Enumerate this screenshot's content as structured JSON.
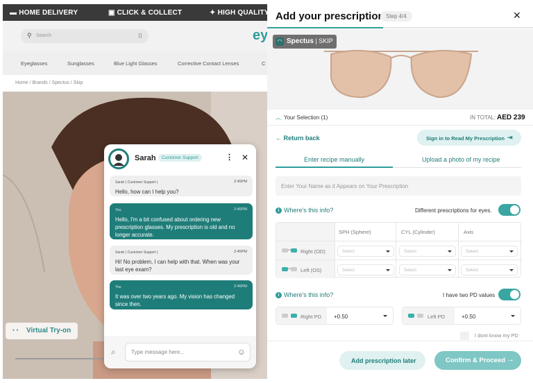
{
  "store": {
    "promo": [
      "HOME DELIVERY",
      "CLICK & COLLECT",
      "HIGH QUALITY"
    ],
    "logo_partial": "ey",
    "search_placeholder": "Search",
    "nav": [
      "Eyeglasses",
      "Sunglasses",
      "Blue Light Glasses",
      "Corrective Contact Lenses",
      "C"
    ],
    "breadcrumb": "Home / Brands / Spectus / Skip",
    "virtual_tryon": "Virtual Try-on"
  },
  "chat": {
    "agent_name": "Sarah",
    "agent_role": "Customer Support",
    "messages": [
      {
        "from": "Sarah ( Customer Support )",
        "time": "2:45PM",
        "text": "Hello, how can I help you?",
        "kind": "agent"
      },
      {
        "from": "You",
        "time": "2:46PM",
        "text": "Hello, I'm a bit confused about ordering new prescription glasses. My prescription is old and no longer accurate.",
        "kind": "user"
      },
      {
        "from": "Sarah ( Customer Support )",
        "time": "2:45PM",
        "text": "Hi! No problem, I can help with that. When was your last eye exam?",
        "kind": "agent"
      },
      {
        "from": "You",
        "time": "2:46PM",
        "text": "It was over two years ago. My vision has changed since then.",
        "kind": "user"
      }
    ],
    "input_placeholder": "Type message here..."
  },
  "panel": {
    "title": "Add your prescription",
    "step": "Step 4/4",
    "brand_tag": {
      "brand": "Spectus",
      "model": " | SKIP"
    },
    "selection_label": "Your Selection (1)",
    "total_label": "IN TOTAL:",
    "total_value": "AED 239",
    "return_back": "Return back",
    "sign_in": "Sign in to Read My Prescription",
    "tabs": [
      "Enter recipe manually",
      "Upload a photo of my recipe"
    ],
    "name_placeholder": "Enter Your Name as it Appears on Your Prescription",
    "where_info": "Where's this info?",
    "different_rx": "Different prescriptions for eyes.",
    "rx_columns": [
      "SPH (Sphere)",
      "CYL (Cylinder)",
      "Axis"
    ],
    "rx_rows": [
      "Right (OD)",
      "Left (OS)"
    ],
    "select_placeholder": "Select",
    "two_pd": "I have two PD values",
    "right_pd_label": "Right PD",
    "right_pd_value": "+0.50",
    "left_pd_label": "Left PD",
    "left_pd_value": "+0.50",
    "dont_know_pd": "I dont know my PD",
    "add_later": "Add prescription later",
    "confirm": "Confirm & Proceed"
  },
  "colors": {
    "teal": "#2f9d99",
    "teal_dark": "#1f7d79",
    "light_teal": "#dff1f0"
  }
}
